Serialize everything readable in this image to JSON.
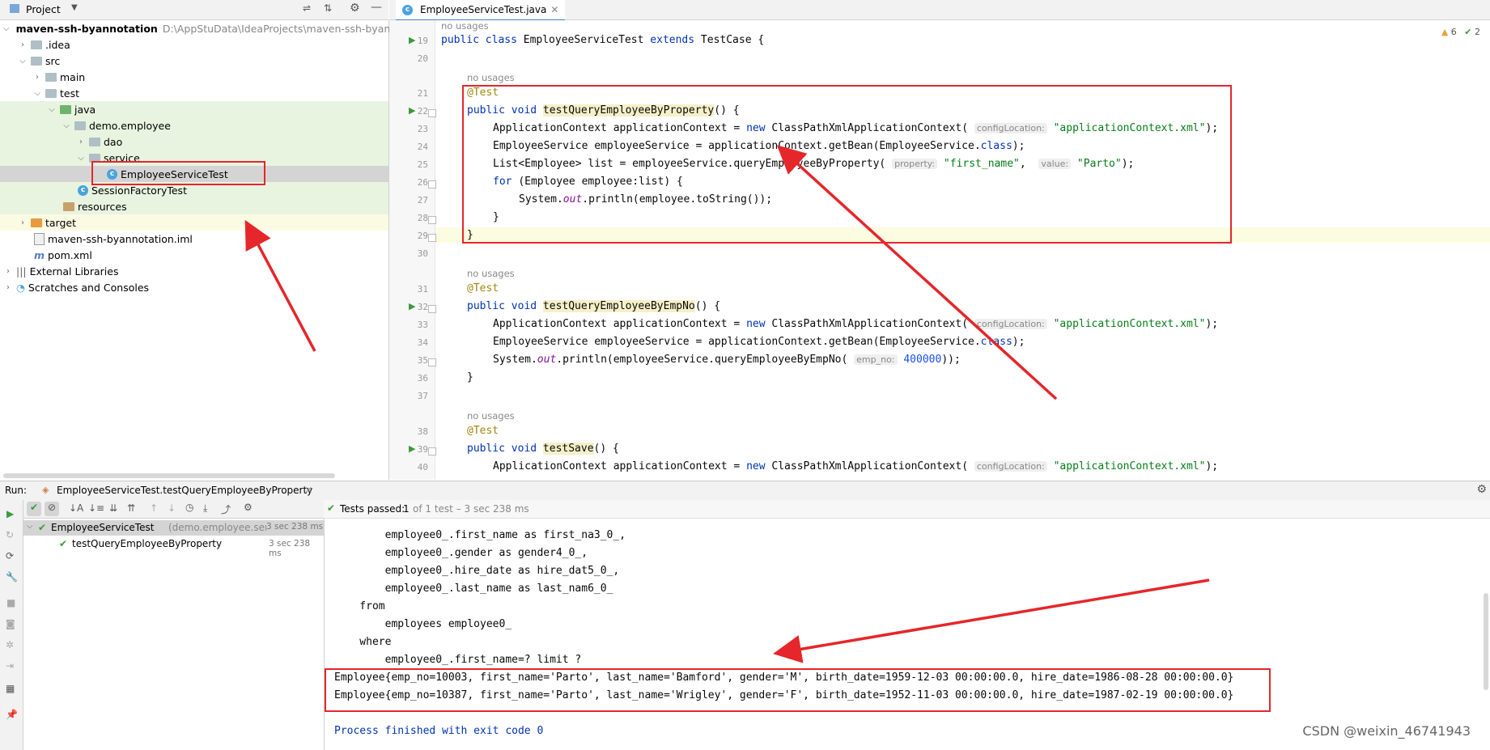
{
  "project_panel": {
    "title": "Project",
    "tree": [
      {
        "label": "maven-ssh-byannotation",
        "path": "D:\\AppStuData\\IdeaProjects\\maven-ssh-byanno"
      },
      {
        "label": ".idea"
      },
      {
        "label": "src"
      },
      {
        "label": "main"
      },
      {
        "label": "test"
      },
      {
        "label": "java"
      },
      {
        "label": "demo.employee"
      },
      {
        "label": "dao"
      },
      {
        "label": "service"
      },
      {
        "label": "EmployeeServiceTest"
      },
      {
        "label": "SessionFactoryTest"
      },
      {
        "label": "resources"
      },
      {
        "label": "target"
      },
      {
        "label": "maven-ssh-byannotation.iml"
      },
      {
        "label": "pom.xml"
      },
      {
        "label": "External Libraries"
      },
      {
        "label": "Scratches and Consoles"
      }
    ]
  },
  "editor": {
    "tab_label": "EmployeeServiceTest.java",
    "inspection": {
      "warnings": "6",
      "checks": "2"
    },
    "hint_no_usages": "no usages",
    "line_numbers": [
      "19",
      "20",
      "21",
      "22",
      "23",
      "24",
      "25",
      "26",
      "27",
      "28",
      "29",
      "30",
      "31",
      "32",
      "33",
      "34",
      "35",
      "36",
      "37",
      "38",
      "39",
      "40"
    ],
    "t_public_class": "public class ",
    "t_class_name": "EmployeeServiceTest ",
    "t_extends": "extends ",
    "t_testcase": "TestCase {",
    "t_test_anno": "@Test",
    "t_public_void": "public void ",
    "m1_name": "testQueryEmployeeByProperty",
    "m2_name": "testQueryEmployeeByEmpNo",
    "m3_name": "testSave",
    "t_paren_open": "() {",
    "t_ctx_decl": "ApplicationContext applicationContext = ",
    "t_new": "new ",
    "t_cpx": "ClassPathXmlApplicationContext(",
    "ph_config": "configLocation:",
    "s_appctx": "\"applicationContext.xml\"",
    "t_close_semi": ");",
    "t_svc_decl": "EmployeeService employeeService = applicationContext.getBean(EmployeeService.",
    "t_class_kw": "class",
    "t_list_decl": "List<Employee> list = employeeService.queryEmployeeByProperty(",
    "ph_property": "property:",
    "s_first_name": "\"first_name\"",
    "t_comma": ", ",
    "ph_value": "value:",
    "s_parto": "\"Parto\"",
    "t_for": "for ",
    "t_for_rest": "(Employee employee:list) {",
    "t_system": "System.",
    "t_out": "out",
    "t_println_emp": ".println(employee.toString());",
    "t_println_by_no": ".println(employeeService.queryEmployeeByEmpNo(",
    "ph_emp_no": "emp_no:",
    "n_400000": "400000",
    "t_close2": "));",
    "t_brace": "}"
  },
  "run_panel": {
    "label": "Run:",
    "config_tab": "EmployeeServiceTest.testQueryEmployeeByProperty",
    "status_passed": "Tests passed:",
    "status_count": "1",
    "status_rest": "of 1 test – 3 sec 238 ms",
    "tree": [
      {
        "label": "EmployeeServiceTest",
        "detail": "(demo.employee.servic",
        "time": "3 sec 238 ms"
      },
      {
        "label": "testQueryEmployeeByProperty",
        "time": "3 sec 238 ms"
      }
    ],
    "console_lines": [
      "        employee0_.first_name as first_na3_0_,",
      "        employee0_.gender as gender4_0_,",
      "        employee0_.hire_date as hire_dat5_0_,",
      "        employee0_.last_name as last_nam6_0_",
      "    from",
      "        employees employee0_",
      "    where",
      "        employee0_.first_name=? limit ?",
      "Employee{emp_no=10003, first_name='Parto', last_name='Bamford', gender='M', birth_date=1959-12-03 00:00:00.0, hire_date=1986-08-28 00:00:00.0}",
      "Employee{emp_no=10387, first_name='Parto', last_name='Wrigley', gender='F', birth_date=1952-11-03 00:00:00.0, hire_date=1987-02-19 00:00:00.0}",
      "",
      "Process finished with exit code 0"
    ]
  },
  "watermark": "CSDN @weixin_46741943",
  "colors": {
    "annotation_box": "#e5262a",
    "keyword": "#0033b3",
    "string": "#067d17",
    "annotation": "#9e880d"
  }
}
